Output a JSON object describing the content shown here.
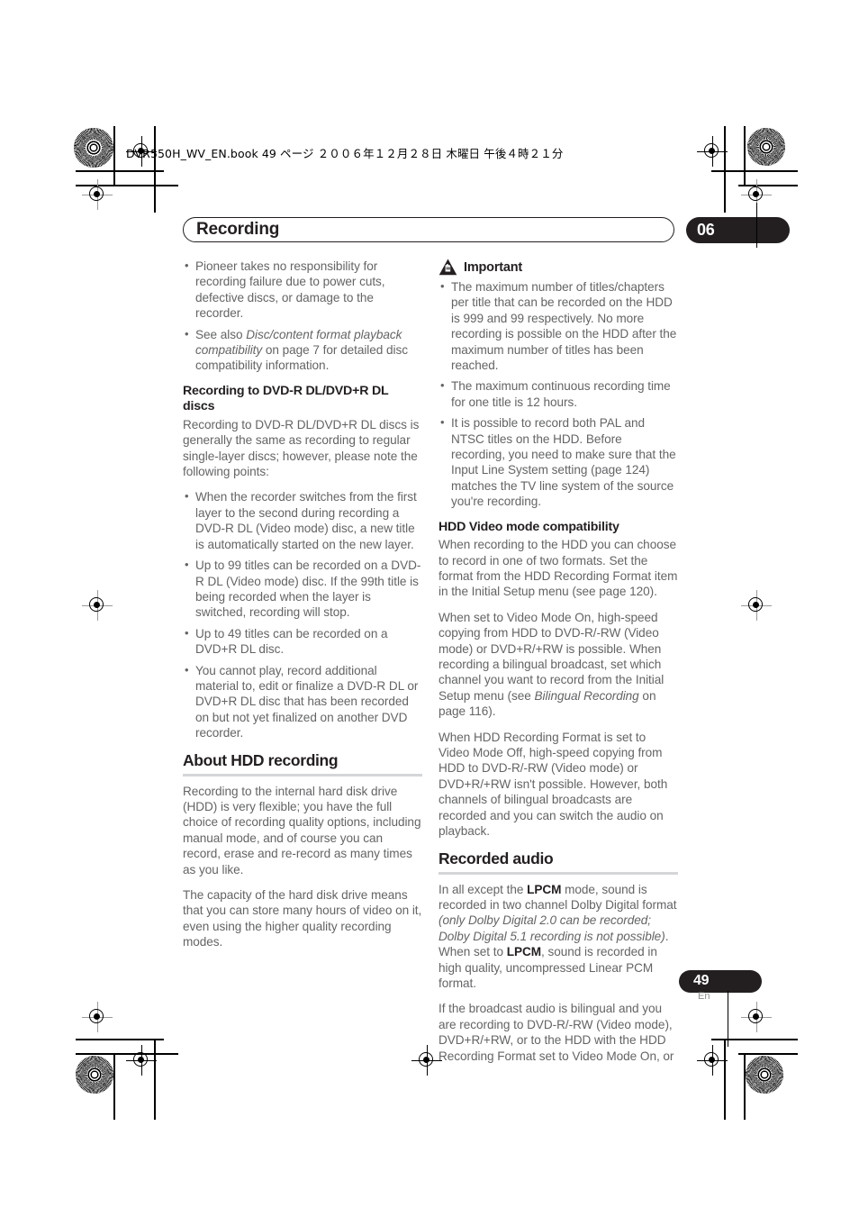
{
  "book_header": "DVR550H_WV_EN.book  49 ページ  ２００６年１２月２８日   木曜日   午後４時２１分",
  "chapter": {
    "title": "Recording",
    "number": "06"
  },
  "footer": {
    "page_number": "49",
    "language": "En"
  },
  "colors": {
    "ink": "#231f20",
    "body": "#636466",
    "rule": "#d5d6d8"
  },
  "left_column": {
    "intro_bullets": [
      "Pioneer takes no responsibility for recording failure due to power cuts, defective discs, or damage to the recorder.",
      "See also <i>Disc/content format playback compatibility</i> on page 7 for detailed disc compatibility information."
    ],
    "subsection_title": "Recording to DVD-R DL/DVD+R DL discs",
    "subsection_intro": "Recording to DVD-R DL/DVD+R DL discs is generally the same as recording to regular single-layer discs; however, please note the following points:",
    "subsection_bullets": [
      "When the recorder switches from the first layer to the second during recording a DVD-R DL (Video mode) disc, a new title is automatically started on the new layer.",
      "Up to 99 titles can be recorded on a DVD-R DL (Video mode) disc. If the 99th title is being recorded when the layer is switched, recording will stop.",
      "Up to 49 titles can be recorded on a DVD+R DL disc.",
      "You cannot play, record additional material to, edit or finalize a DVD-R DL or DVD+R DL disc that has been recorded on but not yet finalized on another DVD recorder."
    ],
    "section_title": "About HDD recording",
    "section_paragraphs": [
      "Recording to the internal hard disk drive (HDD) is very flexible; you have the full choice of recording quality options, including manual mode, and of course you can record, erase and re-record as many times as you like.",
      "The capacity of the hard disk drive means that you can store many hours of video on it, even using the higher quality recording modes."
    ]
  },
  "right_column": {
    "important_label": "Important",
    "important_icon": "warning-triangle-hand-icon",
    "important_bullets": [
      "The maximum number of titles/chapters per title that can be recorded on the HDD is 999 and 99 respectively. No more recording is possible on the HDD after the maximum number of titles has been reached.",
      "The maximum continuous recording time for one title is 12 hours.",
      "It is possible to record both PAL and NTSC titles on the HDD. Before recording, you need to make sure that the Input Line System setting (page 124) matches the TV line system of the source you're recording."
    ],
    "subsection_title": "HDD Video mode compatibility",
    "subsection_paragraphs": [
      "When recording to the HDD you can choose to record in one of two formats. Set the format from the HDD Recording Format item in the Initial Setup menu (see page 120).",
      "When set to Video Mode On, high-speed copying from HDD to DVD-R/-RW (Video mode) or DVD+R/+RW is possible. When recording a bilingual broadcast, set which channel you want to record from the Initial Setup menu (see <i>Bilingual Recording</i> on page 116).",
      "When HDD Recording Format is set to Video Mode Off, high-speed copying from HDD to DVD-R/-RW (Video mode) or DVD+R/+RW isn't possible. However, both channels of bilingual broadcasts are recorded and you can switch the audio on playback."
    ],
    "section_title": "Recorded audio",
    "section_paragraphs": [
      "In all except the <b>LPCM</b> mode, sound is recorded in two channel Dolby Digital format <i>(only Dolby Digital 2.0 can be recorded; Dolby Digital 5.1 recording is not possible)</i>. When set to <b>LPCM</b>, sound is recorded in high quality, uncompressed Linear PCM format.",
      "If the broadcast audio is bilingual and you are recording to DVD-R/-RW (Video mode), DVD+R/+RW, or to the HDD with the HDD Recording Format set to Video Mode On, or"
    ]
  }
}
